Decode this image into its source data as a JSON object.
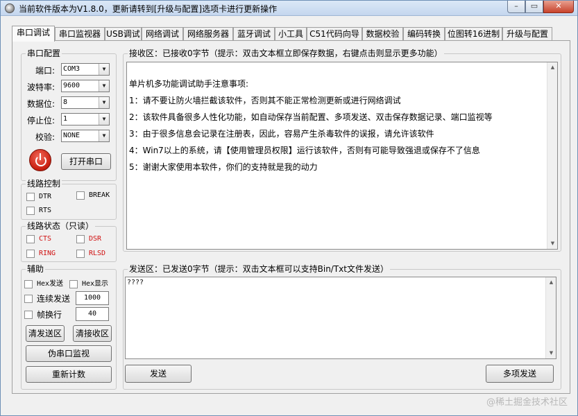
{
  "window": {
    "title": "当前软件版本为V1.8.0，更新请转到[升级与配置]选项卡进行更新操作",
    "min_glyph": "–",
    "max_glyph": "▭",
    "close_glyph": "✕"
  },
  "tabs": [
    {
      "label": "串口调试"
    },
    {
      "label": "串口监视器"
    },
    {
      "label": "USB调试"
    },
    {
      "label": "网络调试"
    },
    {
      "label": "网络服务器"
    },
    {
      "label": "蓝牙调试"
    },
    {
      "label": "小工具"
    },
    {
      "label": "C51代码向导"
    },
    {
      "label": "数据校验"
    },
    {
      "label": "编码转换"
    },
    {
      "label": "位图转16进制"
    },
    {
      "label": "升级与配置"
    }
  ],
  "serial_config": {
    "title": "串口配置",
    "port_label": "端口:",
    "port_value": "COM3",
    "baud_label": "波特率:",
    "baud_value": "9600",
    "databits_label": "数据位:",
    "databits_value": "8",
    "stopbits_label": "停止位:",
    "stopbits_value": "1",
    "parity_label": "校验:",
    "parity_value": "NONE",
    "open_button": "打开串口",
    "combo_arrow": "▼"
  },
  "line_control": {
    "title": "线路控制",
    "dtr": "DTR",
    "break": "BREAK",
    "rts": "RTS"
  },
  "line_status": {
    "title": "线路状态（只读）",
    "cts": "CTS",
    "dsr": "DSR",
    "ring": "RING",
    "rlsd": "RLSD",
    "status_color": "#d01010"
  },
  "aux": {
    "title": "辅助",
    "hex_send": "Hex发送",
    "hex_show": "Hex显示",
    "continuous_send": "连续发送",
    "continuous_value": "1000",
    "frame_newline": "帧换行",
    "frame_value": "40",
    "clear_send": "清发送区",
    "clear_recv": "清接收区",
    "fake_monitor": "伪串口监视",
    "recount": "重新计数"
  },
  "receive": {
    "title": "接收区：已接收0字节（提示：双击文本框立即保存数据，右键点击则显示更多功能）",
    "lines": [
      "单片机多功能调试助手注意事项:",
      "1：请不要让防火墙拦截该软件，否则其不能正常检测更新或进行网络调试",
      "2：该软件具备很多人性化功能，如自动保存当前配置、多项发送、双击保存数据记录、端口监视等",
      "3：由于很多信息会记录在注册表，因此，容易产生杀毒软件的误报，请允许该软件",
      "4：Win7以上的系统，请【使用管理员权限】运行该软件，否则有可能导致强退或保存不了信息",
      "5：谢谢大家使用本软件，你们的支持就是我的动力"
    ]
  },
  "send": {
    "title": "发送区：已发送0字节（提示：双击文本框可以支持Bin/Txt文件发送）",
    "content": "????",
    "send_button": "发送",
    "multi_send_button": "多项发送"
  },
  "scroll": {
    "up": "▲",
    "down": "▼"
  },
  "watermark": "@稀土掘金技术社区"
}
